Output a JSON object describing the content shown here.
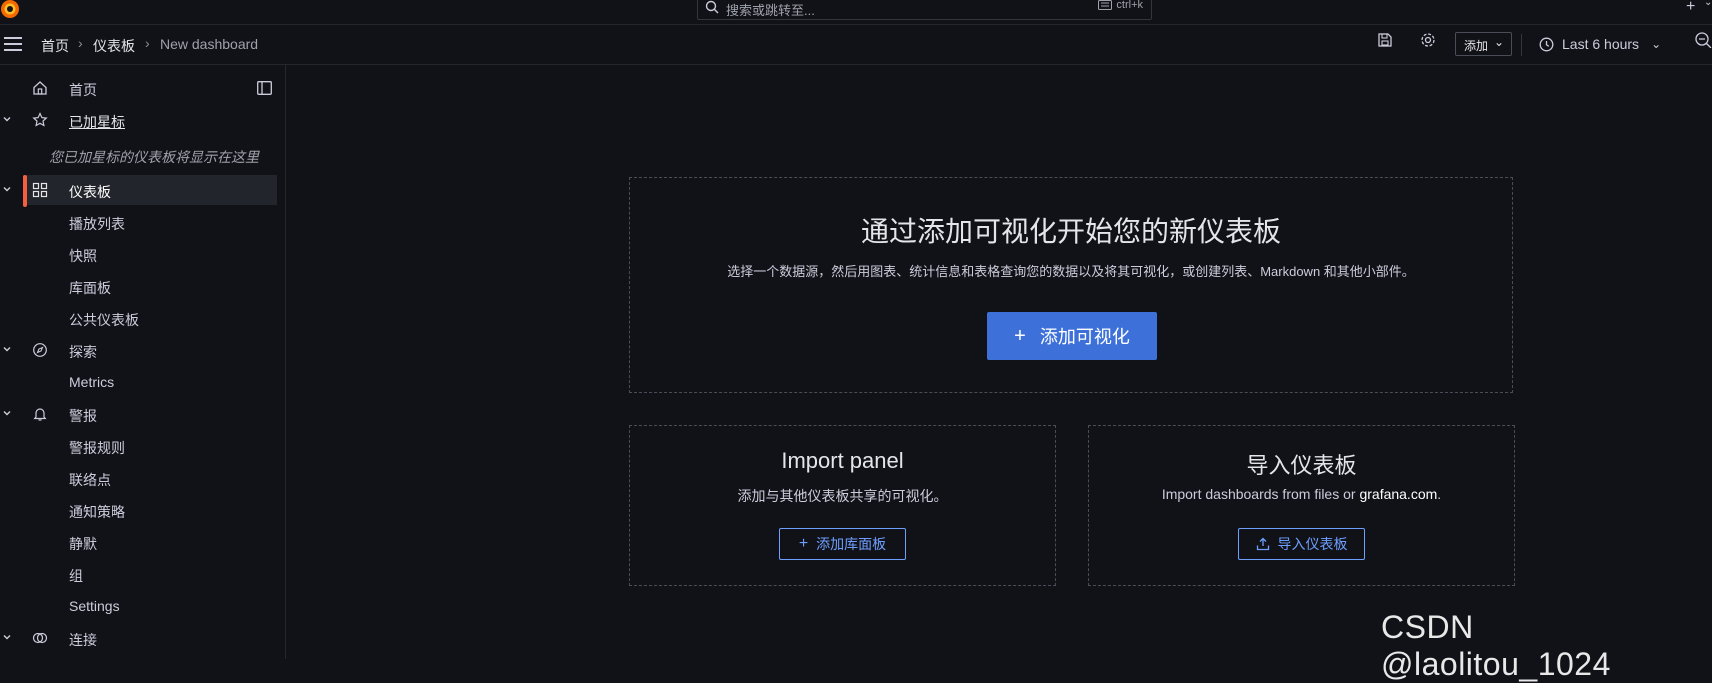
{
  "topbar": {
    "search_placeholder": "搜索或跳转至...",
    "search_shortcut": "ctrl+k"
  },
  "breadcrumb": {
    "home": "首页",
    "dashboards": "仪表板",
    "current": "New dashboard"
  },
  "toolbar": {
    "add_label": "添加",
    "time_range": "Last 6 hours"
  },
  "sidebar": {
    "items": [
      {
        "label": "首页",
        "icon": "home-icon"
      },
      {
        "label": "已加星标",
        "icon": "star-icon"
      },
      {
        "label": "仪表板",
        "icon": "apps-icon"
      },
      {
        "label": "播放列表"
      },
      {
        "label": "快照"
      },
      {
        "label": "库面板"
      },
      {
        "label": "公共仪表板"
      },
      {
        "label": "探索",
        "icon": "compass-icon"
      },
      {
        "label": "Metrics"
      },
      {
        "label": "警报",
        "icon": "bell-icon"
      },
      {
        "label": "警报规则"
      },
      {
        "label": "联络点"
      },
      {
        "label": "通知策略"
      },
      {
        "label": "静默"
      },
      {
        "label": "组"
      },
      {
        "label": "Settings"
      },
      {
        "label": "连接",
        "icon": "connections-icon"
      }
    ],
    "starred_empty_note": "您已加星标的仪表板将显示在这里"
  },
  "empty_state": {
    "title": "通过添加可视化开始您的新仪表板",
    "description": "选择一个数据源，然后用图表、统计信息和表格查询您的数据以及将其可视化，或创建列表、Markdown 和其他小部件。",
    "button": "添加可视化"
  },
  "import_panel": {
    "title": "Import panel",
    "description": "添加与其他仪表板共享的可视化。",
    "button": "添加库面板"
  },
  "import_dashboard": {
    "title": "导入仪表板",
    "description_prefix": "Import dashboards from files or ",
    "description_link": "grafana.com",
    "description_suffix": ".",
    "button": "导入仪表板"
  },
  "watermark": "CSDN @laolitou_1024",
  "colors": {
    "background": "#111217",
    "primary": "#3d71d9",
    "accent": "#f55f3e",
    "link": "#6e9fff"
  }
}
